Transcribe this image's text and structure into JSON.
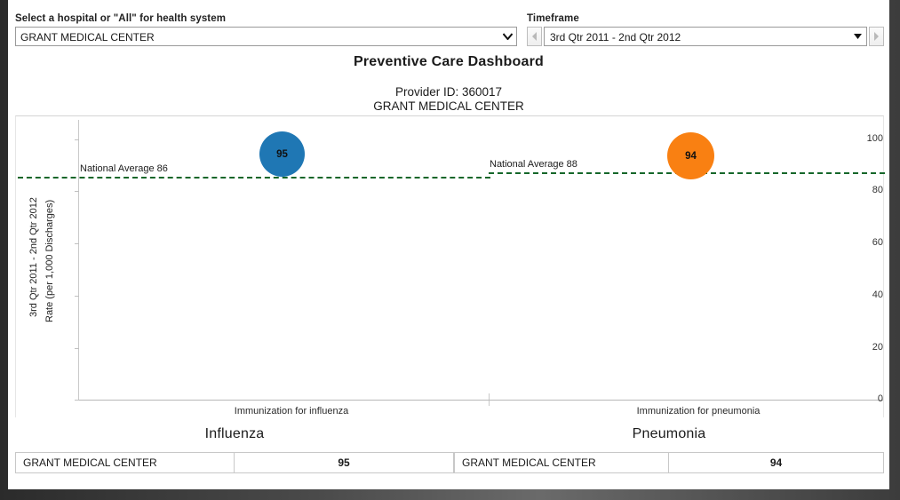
{
  "controls": {
    "hospital_label": "Select a hospital or \"All\" for health system",
    "hospital_value": "GRANT MEDICAL CENTER",
    "hospital_caret": "chevron-down-icon",
    "timeframe_label": "Timeframe",
    "timeframe_value": "3rd Qtr 2011 - 2nd Qtr 2012",
    "timeframe_prev": "◀",
    "timeframe_next": "▶",
    "timeframe_caret": "▼"
  },
  "header": {
    "title": "Preventive Care Dashboard",
    "provider_id": "Provider ID: 360017",
    "provider_name": "GRANT MEDICAL CENTER"
  },
  "chart_data": {
    "type": "scatter",
    "title": "Preventive Care Dashboard",
    "xlabel": "",
    "ylabel": "Rate (per 1,000 Discharges)",
    "ylabel2": "3rd Qtr 2011 - 2nd Qtr 2012",
    "ylim": [
      0,
      100
    ],
    "yticks": [
      0,
      20,
      40,
      60,
      80,
      100
    ],
    "grid": false,
    "legend": "none",
    "categories": [
      "Immunization for influenza",
      "Immunization for pneumonia"
    ],
    "series": [
      {
        "name": "GRANT MEDICAL CENTER",
        "values": [
          95,
          94
        ],
        "colors": [
          "#1f77b4",
          "#f98012"
        ],
        "labels": [
          "95",
          "94"
        ]
      }
    ],
    "reference_lines": [
      {
        "label": "National Average 86",
        "value": 86,
        "color": "#15672a",
        "style": "dashed",
        "panel": 0
      },
      {
        "label": "National Average 88",
        "value": 88,
        "color": "#15672a",
        "style": "dashed",
        "panel": 1
      }
    ]
  },
  "panels": [
    {
      "group_title": "Influenza",
      "category_label": "Immunization for influenza",
      "bubble_value": "95",
      "natavg_label": "National Average 86",
      "table": {
        "headers": [],
        "rows": [
          [
            "GRANT MEDICAL CENTER",
            "95"
          ]
        ]
      }
    },
    {
      "group_title": "Pneumonia",
      "category_label": "Immunization for pneumonia",
      "bubble_value": "94",
      "natavg_label": "National Average 88",
      "table": {
        "headers": [],
        "rows": [
          [
            "GRANT MEDICAL CENTER",
            "94"
          ]
        ]
      }
    }
  ],
  "axis": {
    "ticks": [
      "100",
      "80",
      "60",
      "40",
      "20",
      "0"
    ]
  },
  "colors": {
    "series_influenza": "#1f77b4",
    "series_pneumonia": "#f98012",
    "reference_line": "#15672a"
  }
}
